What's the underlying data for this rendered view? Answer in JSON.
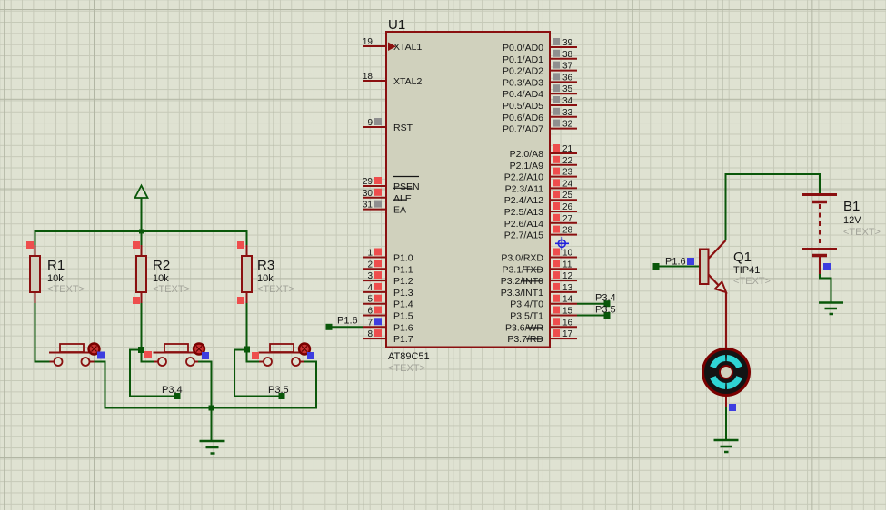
{
  "ic": {
    "ref": "U1",
    "part": "AT89C51",
    "placeholder": "<TEXT>",
    "left_pins": [
      {
        "num": "19",
        "label": "XTAL1",
        "color": "none"
      },
      {
        "num": "18",
        "label": "XTAL2",
        "color": "none"
      },
      {
        "num": "9",
        "label": "RST",
        "color": "#8f8f8f"
      },
      {
        "num": "29",
        "label": "PSEN",
        "color": "#ee4d4d"
      },
      {
        "num": "30",
        "label": "ALE",
        "color": "#ee4d4d"
      },
      {
        "num": "31",
        "label": "EA",
        "color": "#8f8f8f"
      },
      {
        "num": "1",
        "label": "P1.0",
        "color": "#ee4d4d"
      },
      {
        "num": "2",
        "label": "P1.1",
        "color": "#ee4d4d"
      },
      {
        "num": "3",
        "label": "P1.2",
        "color": "#ee4d4d"
      },
      {
        "num": "4",
        "label": "P1.3",
        "color": "#ee4d4d"
      },
      {
        "num": "5",
        "label": "P1.4",
        "color": "#ee4d4d"
      },
      {
        "num": "6",
        "label": "P1.5",
        "color": "#ee4d4d"
      },
      {
        "num": "7",
        "label": "P1.6",
        "color": "#3d3de0"
      },
      {
        "num": "8",
        "label": "P1.7",
        "color": "#ee4d4d"
      }
    ],
    "right_pins": [
      {
        "num": "39",
        "label": "P0.0/AD0",
        "color": "#8f8f8f"
      },
      {
        "num": "38",
        "label": "P0.1/AD1",
        "color": "#8f8f8f"
      },
      {
        "num": "37",
        "label": "P0.2/AD2",
        "color": "#8f8f8f"
      },
      {
        "num": "36",
        "label": "P0.3/AD3",
        "color": "#8f8f8f"
      },
      {
        "num": "35",
        "label": "P0.4/AD4",
        "color": "#8f8f8f"
      },
      {
        "num": "34",
        "label": "P0.5/AD5",
        "color": "#8f8f8f"
      },
      {
        "num": "33",
        "label": "P0.6/AD6",
        "color": "#8f8f8f"
      },
      {
        "num": "32",
        "label": "P0.7/AD7",
        "color": "#8f8f8f"
      },
      {
        "num": "21",
        "label": "P2.0/A8",
        "color": "#ee4d4d"
      },
      {
        "num": "22",
        "label": "P2.1/A9",
        "color": "#ee4d4d"
      },
      {
        "num": "23",
        "label": "P2.2/A10",
        "color": "#ee4d4d"
      },
      {
        "num": "24",
        "label": "P2.3/A11",
        "color": "#ee4d4d"
      },
      {
        "num": "25",
        "label": "P2.4/A12",
        "color": "#ee4d4d"
      },
      {
        "num": "26",
        "label": "P2.5/A13",
        "color": "#ee4d4d"
      },
      {
        "num": "27",
        "label": "P2.6/A14",
        "color": "#ee4d4d"
      },
      {
        "num": "28",
        "label": "P2.7/A15",
        "color": "#ee4d4d"
      },
      {
        "num": "10",
        "label": "P3.0/RXD",
        "color": "#ee4d4d"
      },
      {
        "num": "11",
        "label": "P3.1/TXD",
        "color": "#ee4d4d"
      },
      {
        "num": "12",
        "label": "P3.2/INT0",
        "color": "#ee4d4d"
      },
      {
        "num": "13",
        "label": "P3.3/INT1",
        "color": "#ee4d4d"
      },
      {
        "num": "14",
        "label": "P3.4/T0",
        "color": "#ee4d4d"
      },
      {
        "num": "15",
        "label": "P3.5/T1",
        "color": "#ee4d4d"
      },
      {
        "num": "16",
        "label": "P3.6/WR",
        "color": "#ee4d4d"
      },
      {
        "num": "17",
        "label": "P3.7/RD",
        "color": "#ee4d4d"
      }
    ]
  },
  "resistors": [
    {
      "ref": "R1",
      "value": "10k",
      "placeholder": "<TEXT>"
    },
    {
      "ref": "R2",
      "value": "10k",
      "placeholder": "<TEXT>"
    },
    {
      "ref": "R3",
      "value": "10k",
      "placeholder": "<TEXT>"
    }
  ],
  "transistor": {
    "ref": "Q1",
    "part": "TIP41",
    "placeholder": "<TEXT>"
  },
  "battery": {
    "ref": "B1",
    "value": "12V",
    "placeholder": "<TEXT>"
  },
  "nets": {
    "btn2_label": "P3.4",
    "btn3_label": "P3.5",
    "ic_p16": "P1.6",
    "ic_p34": "P3.4",
    "ic_p35": "P3.5",
    "q1_base": "P1.6"
  },
  "colors": {
    "red": "#ee4d4d",
    "blue": "#3d3de0",
    "gray": "#8f8f8f",
    "wire": "#0a570a",
    "component": "#8a1010",
    "cyan": "#2fd4d4"
  }
}
